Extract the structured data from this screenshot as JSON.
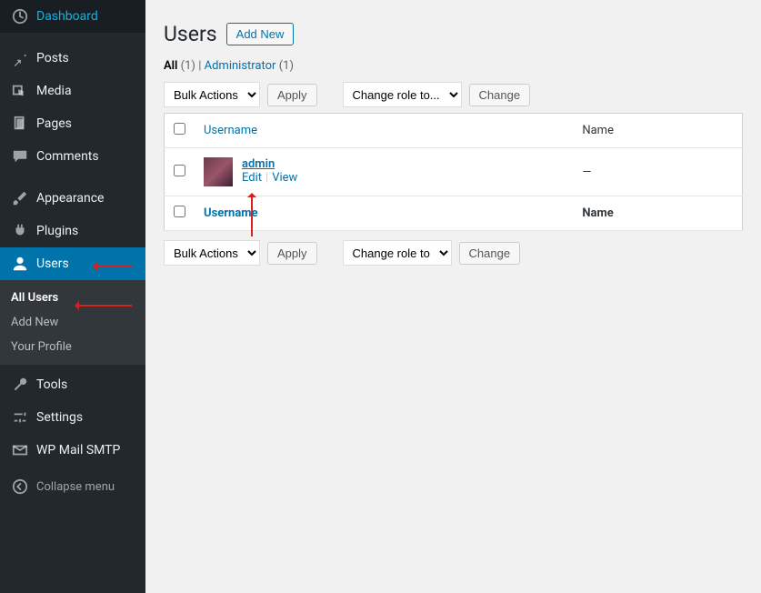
{
  "sidebar": {
    "dashboard": "Dashboard",
    "posts": "Posts",
    "media": "Media",
    "pages": "Pages",
    "comments": "Comments",
    "appearance": "Appearance",
    "plugins": "Plugins",
    "users": "Users",
    "tools": "Tools",
    "settings": "Settings",
    "wpmailsmtp": "WP Mail SMTP",
    "collapse": "Collapse menu",
    "submenu": {
      "all_users": "All Users",
      "add_new": "Add New",
      "your_profile": "Your Profile"
    }
  },
  "page": {
    "title": "Users",
    "add_new": "Add New"
  },
  "filters": {
    "all_label": "All",
    "all_count": "(1)",
    "admin_label": "Administrator",
    "admin_count": "(1)",
    "separator": " | "
  },
  "bulk": {
    "actions": "Bulk Actions",
    "apply": "Apply",
    "change_role": "Change role to...",
    "change": "Change"
  },
  "table": {
    "col_username": "Username",
    "col_name": "Name",
    "row": {
      "username": "admin",
      "name": "—",
      "edit": "Edit",
      "view": "View"
    }
  }
}
